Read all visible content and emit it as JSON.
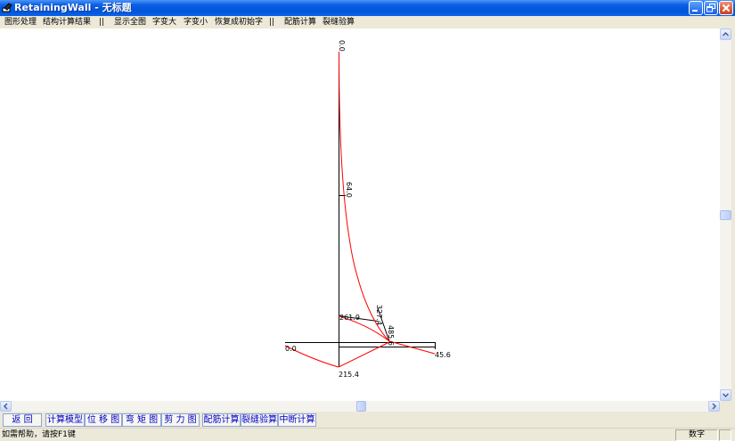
{
  "window": {
    "title": "RetainingWall - 无标题",
    "icons": {
      "app": "app-icon",
      "minimize": "minimize-icon",
      "restore": "restore-icon",
      "close": "close-icon"
    },
    "colors": {
      "title_bar": "#0c5fe4",
      "close_button": "#c8401e"
    }
  },
  "menu": {
    "items": [
      {
        "label": "图形处理"
      },
      {
        "label": "结构计算结果"
      },
      {
        "label": "||"
      },
      {
        "label": "显示全图"
      },
      {
        "label": "字变大"
      },
      {
        "label": "字变小"
      },
      {
        "label": "恢复成初始字"
      },
      {
        "label": "||"
      },
      {
        "label": "配筋计算"
      },
      {
        "label": "裂缝验算"
      }
    ]
  },
  "canvas": {
    "colors": {
      "curve": "#ff0000",
      "axis": "#000000",
      "background": "#ffffff"
    },
    "labels": {
      "wall_top": "0.0",
      "wall_mid": "64.0",
      "wall_lower": "327.4",
      "wall_section": "261.9",
      "wall_base": "485.6",
      "base_left": "0.0",
      "base_right": "45.6",
      "base_bottom": "215.4"
    }
  },
  "scrollbars": {
    "icons": {
      "up": "scroll-up-icon",
      "down": "scroll-down-icon",
      "left": "scroll-left-icon",
      "right": "scroll-right-icon"
    }
  },
  "toolbar": {
    "buttons": [
      {
        "label": "返 回"
      },
      {
        "label": "计算模型"
      },
      {
        "label": "位 移 图"
      },
      {
        "label": "弯 矩 图"
      },
      {
        "label": "剪 力 图"
      },
      {
        "label": "配筋计算"
      },
      {
        "label": "裂缝验算"
      },
      {
        "label": "中断计算"
      }
    ]
  },
  "status": {
    "help_text": "如需帮助，请按F1键",
    "mode_indicator": "数字"
  }
}
